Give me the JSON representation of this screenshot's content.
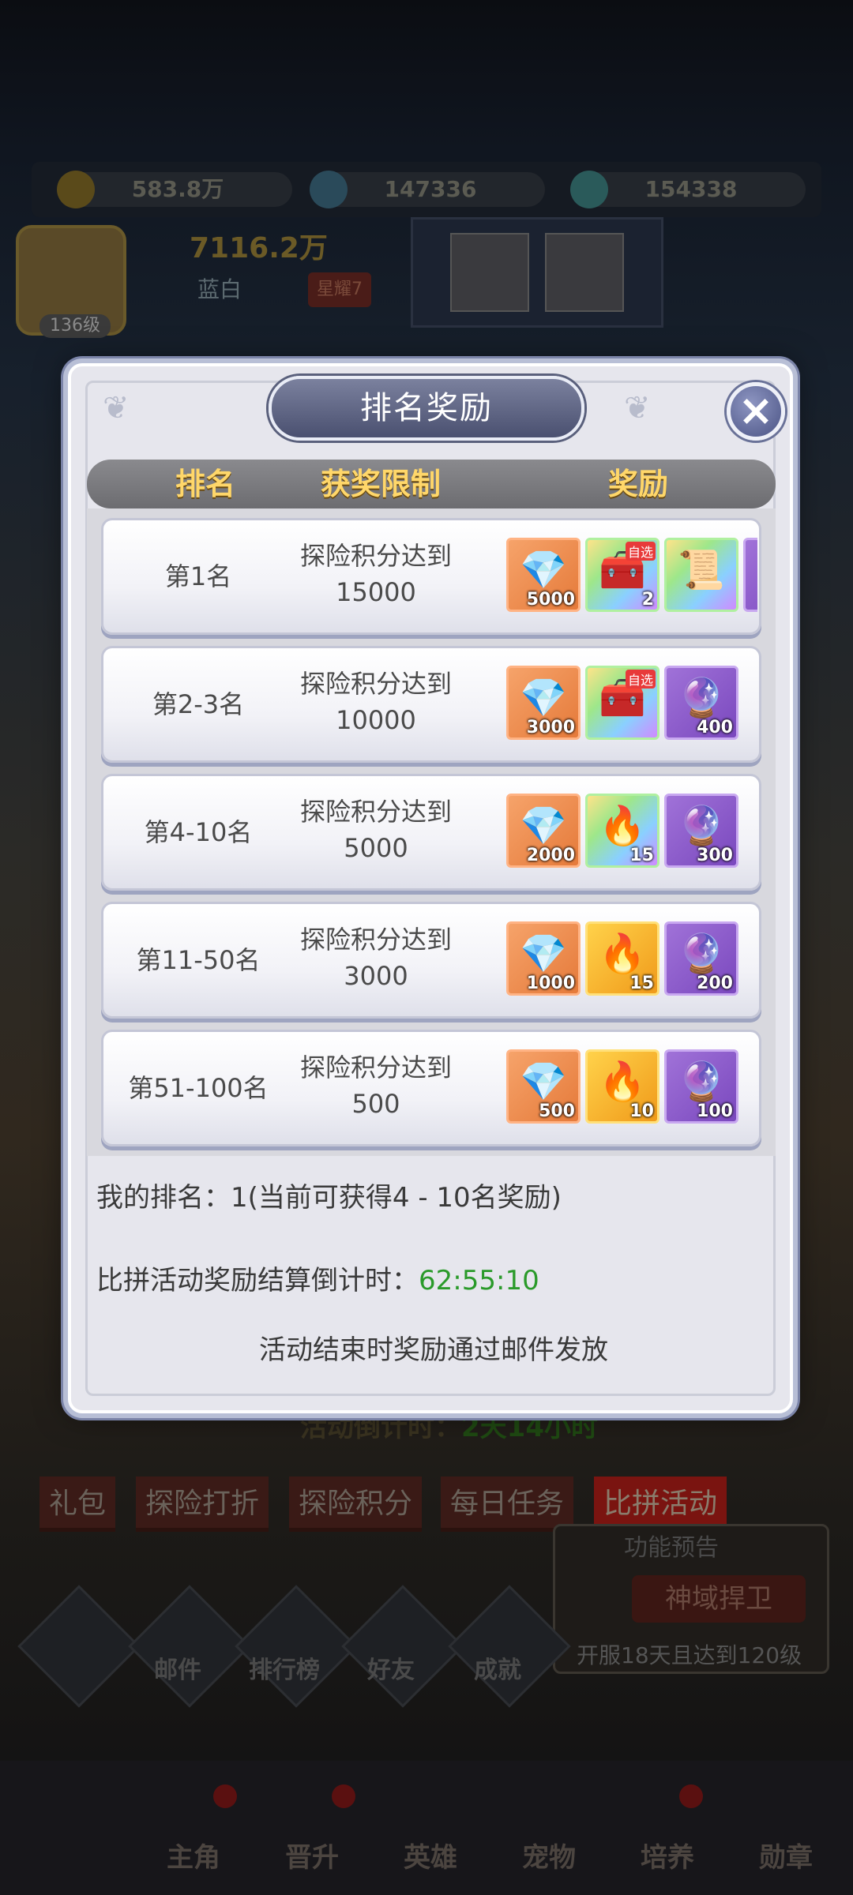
{
  "background": {
    "resources": [
      {
        "icon": "coin-icon",
        "value": "583.8万"
      },
      {
        "icon": "gem-icon",
        "value": "147336"
      },
      {
        "icon": "crystal-icon",
        "value": "154338"
      }
    ],
    "player": {
      "power": "7116.2万",
      "name": "蓝白",
      "level": "136级",
      "star_badge": "星耀7"
    },
    "countdown_label": "活动倒计时：",
    "countdown_value": "2天14小时",
    "tabs": [
      {
        "label": "礼包",
        "active": false
      },
      {
        "label": "探险打折",
        "active": false
      },
      {
        "label": "探险积分",
        "active": false
      },
      {
        "label": "每日任务",
        "active": false
      },
      {
        "label": "比拼活动",
        "active": true
      }
    ],
    "side_panel": {
      "title": "功能预告",
      "button": "神域捍卫",
      "note": "开服18天且达到120级"
    },
    "functions": [
      "邮件",
      "排行榜",
      "好友",
      "成就"
    ],
    "nav": [
      "主角",
      "晋升",
      "英雄",
      "宠物",
      "培养",
      "勋章"
    ]
  },
  "modal": {
    "title": "排名奖励",
    "headers": {
      "rank": "排名",
      "limit": "获奖限制",
      "reward": "奖励"
    },
    "rows": [
      {
        "rank": "第1名",
        "req_line1": "探险积分达到",
        "req_line2": "15000",
        "items": [
          {
            "type": "orange",
            "icon": "diamond-icon",
            "glyph": "💎",
            "qty": "5000"
          },
          {
            "type": "rainbow",
            "icon": "treasure-chest-icon",
            "glyph": "🧰",
            "qty": "2",
            "tag": "自选"
          },
          {
            "type": "rainbow",
            "icon": "scroll-icon",
            "glyph": "📜",
            "qty": ""
          }
        ]
      },
      {
        "rank": "第2-3名",
        "req_line1": "探险积分达到",
        "req_line2": "10000",
        "items": [
          {
            "type": "orange",
            "icon": "diamond-icon",
            "glyph": "💎",
            "qty": "3000"
          },
          {
            "type": "rainbow",
            "icon": "treasure-chest-icon",
            "glyph": "🧰",
            "qty": "",
            "tag": "自选"
          },
          {
            "type": "purple",
            "icon": "crystal-ball-icon",
            "glyph": "🔮",
            "qty": "400"
          }
        ]
      },
      {
        "rank": "第4-10名",
        "req_line1": "探险积分达到",
        "req_line2": "5000",
        "items": [
          {
            "type": "orange",
            "icon": "diamond-icon",
            "glyph": "💎",
            "qty": "2000"
          },
          {
            "type": "rainbow",
            "icon": "rainbow-flame-icon",
            "glyph": "🔥",
            "qty": "15"
          },
          {
            "type": "purple",
            "icon": "crystal-ball-icon",
            "glyph": "🔮",
            "qty": "300"
          }
        ]
      },
      {
        "rank": "第11-50名",
        "req_line1": "探险积分达到",
        "req_line2": "3000",
        "items": [
          {
            "type": "orange",
            "icon": "diamond-icon",
            "glyph": "💎",
            "qty": "1000"
          },
          {
            "type": "gold",
            "icon": "gold-flame-icon",
            "glyph": "🔥",
            "qty": "15"
          },
          {
            "type": "purple",
            "icon": "crystal-ball-icon",
            "glyph": "🔮",
            "qty": "200"
          }
        ]
      },
      {
        "rank": "第51-100名",
        "req_line1": "探险积分达到",
        "req_line2": "500",
        "items": [
          {
            "type": "orange",
            "icon": "diamond-icon",
            "glyph": "💎",
            "qty": "500"
          },
          {
            "type": "gold",
            "icon": "gold-flame-icon",
            "glyph": "🔥",
            "qty": "10"
          },
          {
            "type": "purple",
            "icon": "crystal-ball-icon",
            "glyph": "🔮",
            "qty": "100"
          }
        ]
      }
    ],
    "my_rank": "我的排名：1(当前可获得4 - 10名奖励)",
    "timer_label": "比拼活动奖励结算倒计时：",
    "timer_value": "62:55:10",
    "mail_note": "活动结束时奖励通过邮件发放"
  },
  "colors": {
    "timer": "#2a9a2a",
    "header_text": "#ffd76a",
    "modal_bg": "#e6e6ed"
  }
}
